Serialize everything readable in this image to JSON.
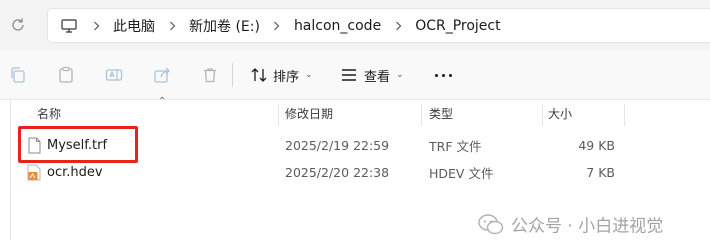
{
  "breadcrumb": {
    "items": [
      "此电脑",
      "新加卷 (E:)",
      "halcon_code",
      "OCR_Project"
    ]
  },
  "toolbar": {
    "sort_label": "排序",
    "view_label": "查看"
  },
  "columns": {
    "name": "名称",
    "modified": "修改日期",
    "type": "类型",
    "size": "大小"
  },
  "files": [
    {
      "name": "Myself.trf",
      "modified": "2025/2/19 22:59",
      "type": "TRF 文件",
      "size": "49 KB",
      "icon": "blank-file-icon",
      "highlighted": true
    },
    {
      "name": "ocr.hdev",
      "modified": "2025/2/20 22:38",
      "type": "HDEV 文件",
      "size": "7 KB",
      "icon": "hdev-file-icon",
      "highlighted": false
    }
  ],
  "watermark": {
    "text": "公众号 · 小白进视觉"
  },
  "colors": {
    "highlight": "#e8231e",
    "hdev_icon": "#f08c2c",
    "watermark": "#a3a3a3"
  }
}
